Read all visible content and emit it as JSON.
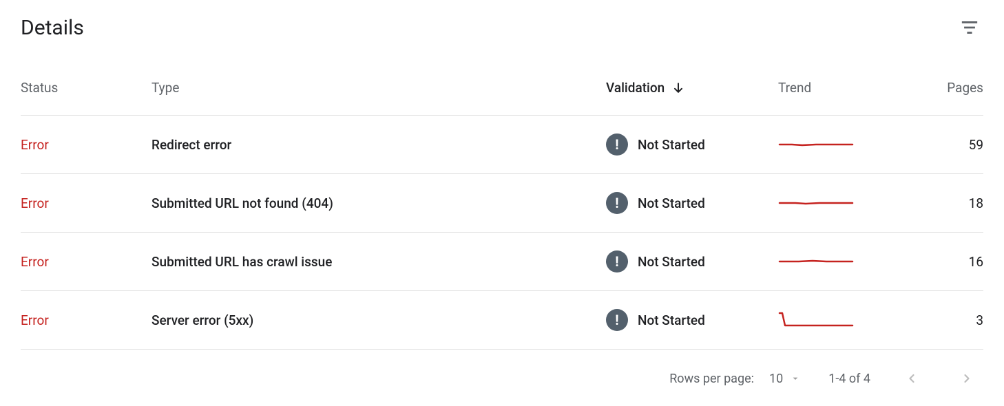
{
  "title": "Details",
  "columns": {
    "status": "Status",
    "type": "Type",
    "validation": "Validation",
    "trend": "Trend",
    "pages": "Pages"
  },
  "sort": {
    "column": "validation",
    "direction": "desc"
  },
  "status_label": "Error",
  "validation_label": "Not Started",
  "rows": [
    {
      "type": "Redirect error",
      "pages": "59",
      "trend": "flat"
    },
    {
      "type": "Submitted URL not found (404)",
      "pages": "18",
      "trend": "flat"
    },
    {
      "type": "Submitted URL has crawl issue",
      "pages": "16",
      "trend": "flat"
    },
    {
      "type": "Server error (5xx)",
      "pages": "3",
      "trend": "drop"
    }
  ],
  "footer": {
    "rows_per_page_label": "Rows per page:",
    "rows_per_page_value": "10",
    "range": "1-4 of 4"
  },
  "chart_data": [
    {
      "type": "line",
      "title": "Redirect error trend",
      "values": [
        59,
        59,
        58,
        59,
        59,
        59,
        59,
        59
      ],
      "ylim": [
        0,
        60
      ]
    },
    {
      "type": "line",
      "title": "Submitted URL not found (404) trend",
      "values": [
        18,
        18,
        18,
        17,
        18,
        18,
        18,
        18
      ],
      "ylim": [
        0,
        60
      ]
    },
    {
      "type": "line",
      "title": "Submitted URL has crawl issue trend",
      "values": [
        16,
        16,
        16,
        16,
        15,
        16,
        16,
        16
      ],
      "ylim": [
        0,
        60
      ]
    },
    {
      "type": "line",
      "title": "Server error (5xx) trend",
      "values": [
        20,
        3,
        3,
        3,
        3,
        3,
        3,
        3
      ],
      "ylim": [
        0,
        60
      ]
    }
  ]
}
